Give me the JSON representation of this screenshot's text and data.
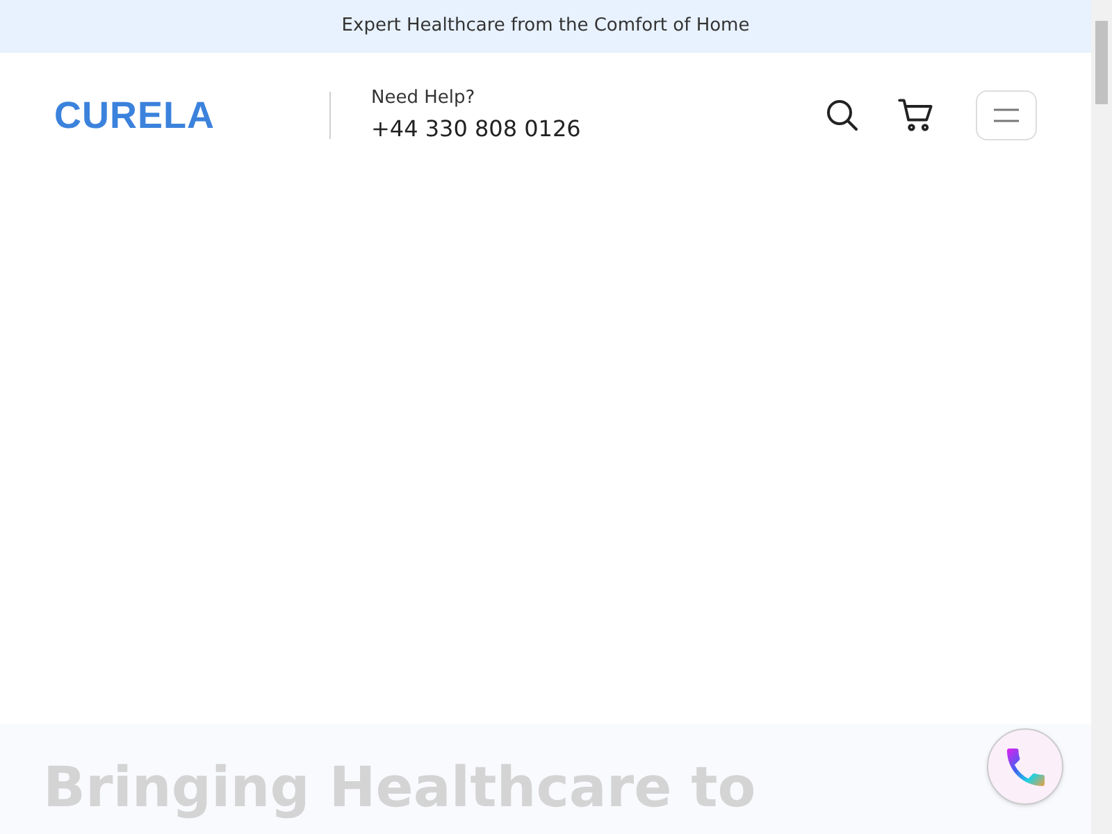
{
  "announcement": "Expert Healthcare from the Comfort of Home",
  "header": {
    "logo": "CURELA",
    "help_label": "Need Help?",
    "phone": "+44 330 808 0126"
  },
  "hero": {
    "heading": "Bringing Healthcare to"
  }
}
